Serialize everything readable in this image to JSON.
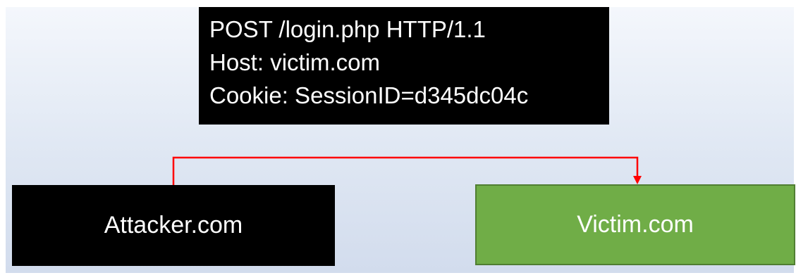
{
  "request": {
    "lines": [
      "POST /login.php HTTP/1.1",
      "Host: victim.com",
      "Cookie: SessionID=d345dc04c"
    ]
  },
  "nodes": {
    "attacker": {
      "label": "Attacker.com",
      "color": "#000000"
    },
    "victim": {
      "label": "Victim.com",
      "color": "#70ad47"
    }
  },
  "connector": {
    "color": "#ff0000"
  }
}
